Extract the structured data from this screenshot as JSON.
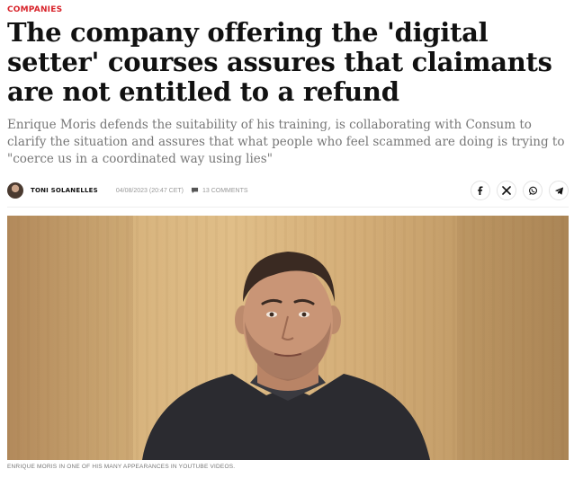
{
  "article": {
    "section": "COMPANIES",
    "headline": "The company offering the 'digital setter' courses assures that claimants are not entitled to a refund",
    "subhead": "Enrique Moris defends the suitability of his training, is collaborating with Consum to clarify the situation and assures that what people who feel scammed are doing is trying to \"coerce us in a coordinated way using lies\"",
    "author": "TONI SOLANELLES",
    "date": "04/08/2023 (20:47 CET)",
    "comments": "13 COMMENTS",
    "caption": "ENRIQUE MORIS IN ONE OF HIS MANY APPEARANCES IN YOUTUBE VIDEOS."
  },
  "share": {
    "icons": [
      "facebook-icon",
      "x-icon",
      "whatsapp-icon",
      "telegram-icon"
    ]
  },
  "colors": {
    "section": "#d8232a",
    "headline": "#111111",
    "subhead": "#777777",
    "meta": "#999999"
  }
}
